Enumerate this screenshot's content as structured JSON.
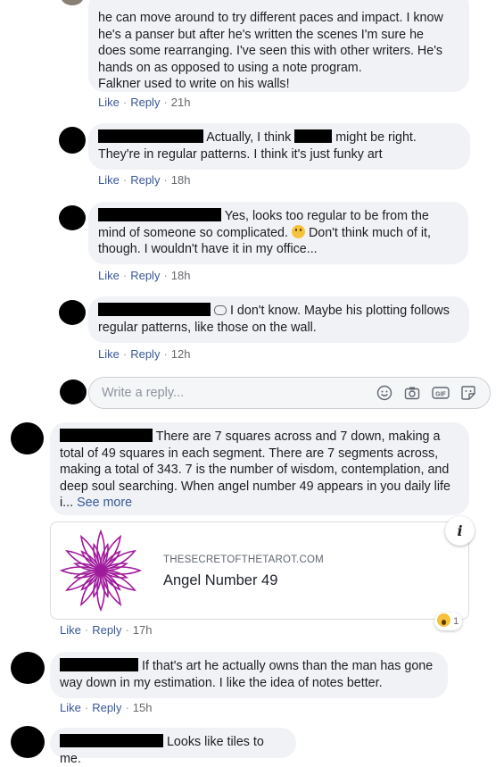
{
  "comments": [
    {
      "lines": [
        "he can move around to try different paces and impact. I know",
        "he's a panser but after he's written the scenes I'm sure he",
        "does some rearranging. I've seen this with other writers. He's",
        "hands on as opposed to using a note program.",
        "Falkner used to write on his walls!"
      ],
      "actions": {
        "like": "Like",
        "reply": "Reply",
        "time": "21h"
      }
    },
    {
      "line1_a": "Actually, I think",
      "line1_b": "might be right.",
      "line2": "They're in regular patterns. I think it's just funky art",
      "actions": {
        "like": "Like",
        "reply": "Reply",
        "time": "18h"
      }
    },
    {
      "line1": "Yes, looks too regular to be from the",
      "line2_a": "mind of someone so complicated.",
      "line2_b": "Don't think much of it,",
      "line3": "though. I wouldn't have it in my office...",
      "actions": {
        "like": "Like",
        "reply": "Reply",
        "time": "18h"
      }
    },
    {
      "line1": "I don't know. Maybe his plotting follows",
      "line2": "regular patterns, like those on the wall.",
      "actions": {
        "like": "Like",
        "reply": "Reply",
        "time": "12h"
      }
    },
    {
      "line1": "There are 7 squares across and 7 down, making a",
      "lines": [
        "total of 49 squares in each segment. There are 7 segments across,",
        "making a total of 343. 7 is the number of wisdom, contemplation, and",
        "deep soul searching. When angel number 49 appears in you daily life"
      ],
      "last_line": "i...",
      "see_more": "See more",
      "link_domain": "THESECRETOFTHETAROT.COM",
      "link_title": "Angel Number 49",
      "reaction_count": "1",
      "actions": {
        "like": "Like",
        "reply": "Reply",
        "time": "17h"
      }
    },
    {
      "line1": "If that's art he actually owns than the man has gone",
      "line2": "way down in my estimation. I like the idea of notes better.",
      "actions": {
        "like": "Like",
        "reply": "Reply",
        "time": "15h"
      }
    },
    {
      "line1": "Looks like tiles to me."
    }
  ],
  "reply_box": {
    "placeholder": "Write a reply..."
  }
}
